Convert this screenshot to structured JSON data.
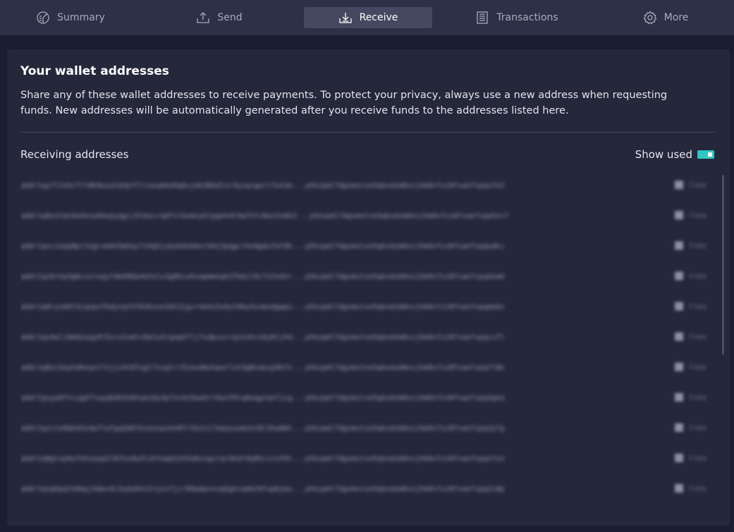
{
  "nav": {
    "tabs": [
      {
        "label": "Summary",
        "icon": "summary-icon"
      },
      {
        "label": "Send",
        "icon": "send-icon"
      },
      {
        "label": "Receive",
        "icon": "receive-icon"
      },
      {
        "label": "Transactions",
        "icon": "transactions-icon"
      },
      {
        "label": "More",
        "icon": "gear-icon"
      }
    ],
    "active_tab": "Receive"
  },
  "panel": {
    "title": "Your wallet addresses",
    "description": "Share any of these wallet addresses to receive payments. To protect your privacy, always use a new address when requesting funds. New addresses will be automatically generated after you receive funds to the addresses listed here.",
    "receiving_label": "Receiving addresses",
    "show_used_label": "Show used",
    "show_used_on": true
  },
  "colors": {
    "accent": "#2fc6c3",
    "background": "#1b1d30",
    "panel": "#25273b",
    "nav": "#2d3047",
    "active_tab": "#454860"
  },
  "addresses": [
    {
      "address": "addr1qy7l2xhcfrt8k9uzwlm3p7tlcaxwmhd4q6vjmk38hdlsr4yzqrgeclfwtnm...yhkzpml7dgvmxtve5qkxdzm0xvjhm9vfzz8fvaefvpqxtk2",
      "copy_label": "Copy"
    },
    {
      "address": "addr1q8xnlmz4uhhvw5mvpyqgcj5lmxcrqdfvlknmvyhlpgeh4t9qfhfc8wz2s0k3...yhkzpml7dgvmxtve5qkxdzm0xvjhm9vfzz8fvaefvpp5vc7",
      "copy_label": "Copy"
    },
    {
      "address": "addr1qxczuqa8pr2ugcxm4n5mhqz7z9qhjukahdxmkerk0z2pqgclhndgdu7wfdh...yhkzpml7dgvmxtve5qkxdzm0xvjhm9vfzz8fvaefvpqwdkj",
      "copy_label": "Copy"
    },
    {
      "address": "addr1qz6rnp3g0cxvruqyfdmd96p4ehslu3g8kcw5vapmmnqk2fhmjl0c7s2xdnr...yhkzpml7dgvmxtve5qkxdzm0xvjhm9vfzz8fvaefvpqdxm6",
      "copy_label": "Copy"
    },
    {
      "address": "addr1q9ryx8dl4jqnpzfkdyvqt5f63kzxe2mt3jgvr4ehx5x6yt9kw3vnmzdgwpz...yhkzpml7dgvmxtve5qkxdzm0xvjhm9vfzz8fvaefvpqme6z",
      "copy_label": "Copy"
    },
    {
      "address": "addr1qx4wlj6mdzuqy0l5zcx2vmtx9alw3rgnpkfljfsdpvzcrqtexhrs6y0tjhd...yhkzpml7dgvmxtve5qkxdzm0xvjhm9vfzz8fvaefvpqcx7l",
      "copy_label": "Copy"
    },
    {
      "address": "addr1q8zz3wyhdkeqzt7xjjz4t07ugl7xvglrr5zeudmxhpwrlzn3g8vaezp9kfx...yhkzpml7dgvmxtve5qkxdzm0xvjhm9vfzz8fvaefvpq7l8k",
      "copy_label": "Copy"
    },
    {
      "address": "addr1qxyw9ftcugd7lwyq6dh2n6hymj6y3p7zx4z5ww5rt0ynf8lq0uqgtqnfjcg...yhkzpml7dgvmxtve5qkxdzm0xvjhm9vfzz8fvaefvpq3qea",
      "copy_label": "Copy"
    },
    {
      "address": "addr1qzcrw9qhd3z4p7lwfgq2m6tkvexuavhn8fr3kznjl6qnyxwmxhz8r2kq9mt...yhkzpml7dgvmxtve5qkxdzm0xvjhm9vfzz8fvaefvpq3y7g",
      "copy_label": "Copy"
    },
    {
      "address": "addr1q8gtxp9u7ekxaup2l87nvdw3lxhfwqm2xh5a8zvgurqr4kdr9q9hcsluf0t...yhkzpml7dgvmxtve5qkxdzm0xvjhm9vfzz8fvaefvpqt7x2",
      "copy_label": "Copy"
    },
    {
      "address": "addr1qxqhpqfa5myj4dwv4c3udz8ns2ryzzfjcr88adpvnxq5ghcwmk29fup0jmx...yhkzpml7dgvmxtve5qkxdzm0xvjhm9vfzz8fvaefvpq2c8p",
      "copy_label": "Copy"
    }
  ]
}
